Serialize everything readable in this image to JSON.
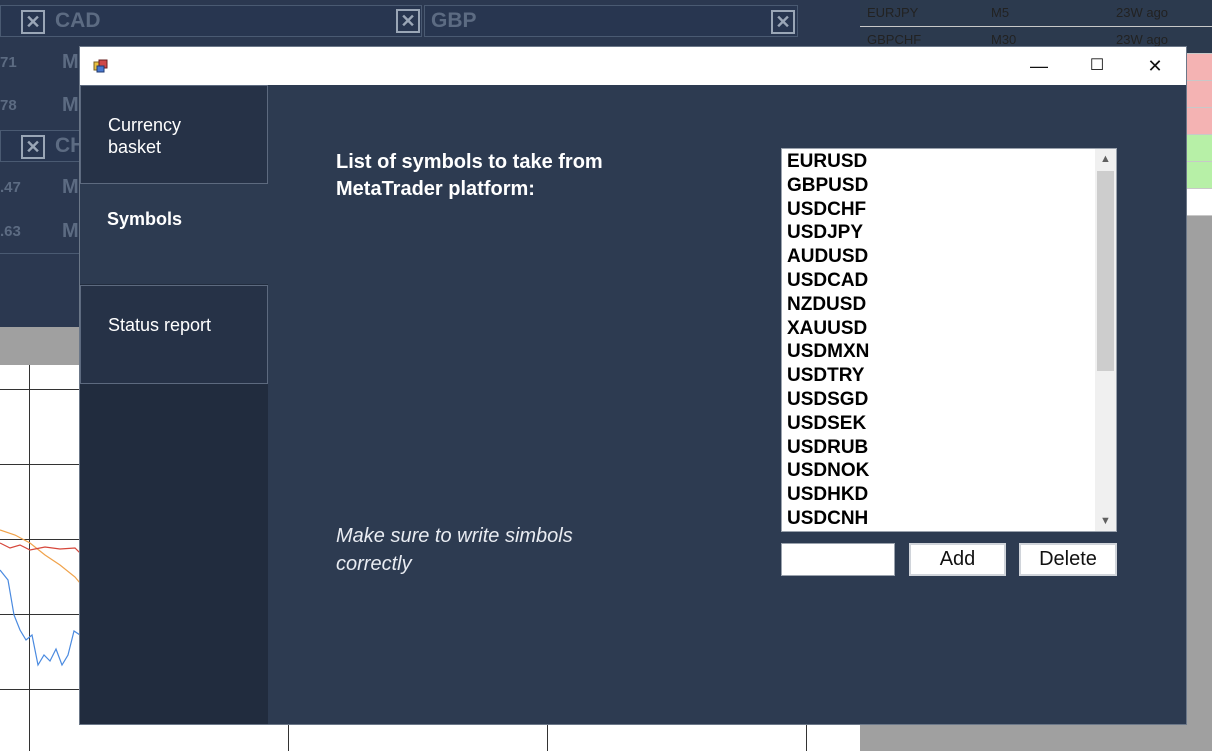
{
  "background": {
    "panels": [
      {
        "title": "CAD",
        "numbers": [
          "71",
          "78"
        ]
      },
      {
        "title": "GBP"
      },
      {
        "title": "CH",
        "numbers": [
          ".47",
          ".63"
        ]
      }
    ],
    "panel_letter": "M",
    "table_rows": [
      {
        "symbol": "EURJPY",
        "tf": "M5",
        "age": "23W ago",
        "color": "#b7f0a7"
      },
      {
        "symbol": "GBPCHF",
        "tf": "M30",
        "age": "23W ago",
        "color": "#b7f0a7"
      }
    ]
  },
  "dialog": {
    "window_controls": {
      "minimize": "—",
      "maximize": "☐",
      "close": "✕"
    },
    "sidebar": [
      {
        "label": "Currency basket"
      },
      {
        "label": "Symbols"
      },
      {
        "label": "Status report"
      }
    ],
    "title": "List of symbols to take from MetaTrader platform:",
    "note": "Make sure to write simbols correctly",
    "symbols": [
      "EURUSD",
      "GBPUSD",
      "USDCHF",
      "USDJPY",
      "AUDUSD",
      "USDCAD",
      "NZDUSD",
      "XAUUSD",
      "USDMXN",
      "USDTRY",
      "USDSGD",
      "USDSEK",
      "USDRUB",
      "USDNOK",
      "USDHKD",
      "USDCNH"
    ],
    "input_value": "",
    "add_label": "Add",
    "delete_label": "Delete",
    "colors": {
      "panel": "#2d3b51",
      "sidebar": "#212c3e"
    }
  }
}
